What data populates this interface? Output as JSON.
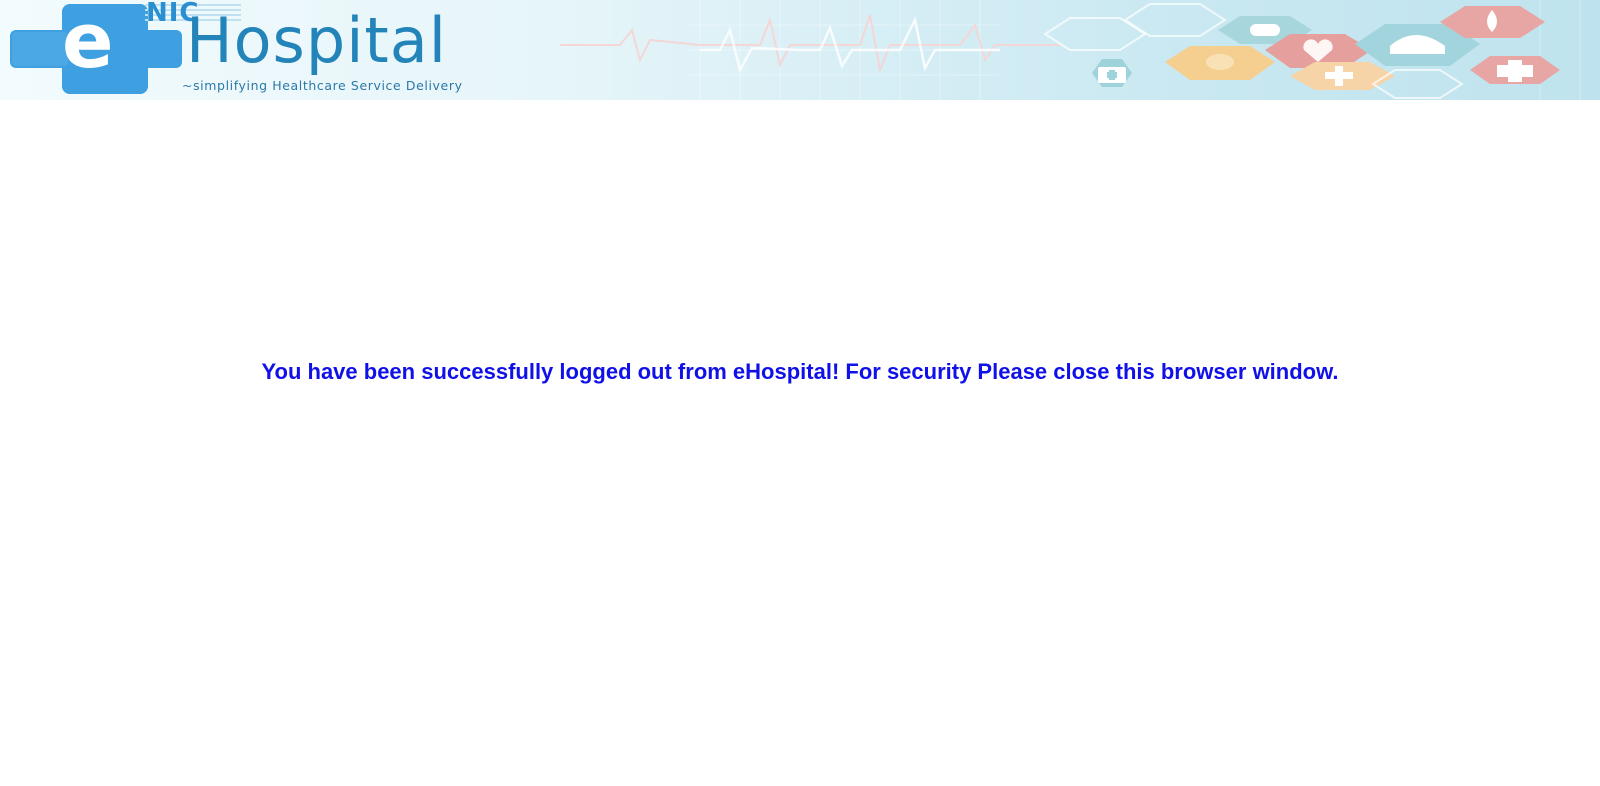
{
  "header": {
    "logo_prefix": "NIC",
    "logo_wordmark": "Hospital",
    "logo_letter": "e",
    "tagline": "~simplifying Healthcare Service Delivery",
    "banner_icons": [
      "first-aid-kit-icon",
      "pill-icon",
      "capsule-icon",
      "heart-monitor-icon",
      "nurse-cap-icon",
      "medical-cross-icon",
      "blood-drop-icon",
      "caduceus-icon"
    ]
  },
  "main": {
    "logout_message": "You have been successfully logged out from eHospital! For security Please close this browser window."
  },
  "colors": {
    "message": "#1010e8",
    "brand_blue": "#3aa0e0",
    "brand_text": "#2284b8"
  }
}
